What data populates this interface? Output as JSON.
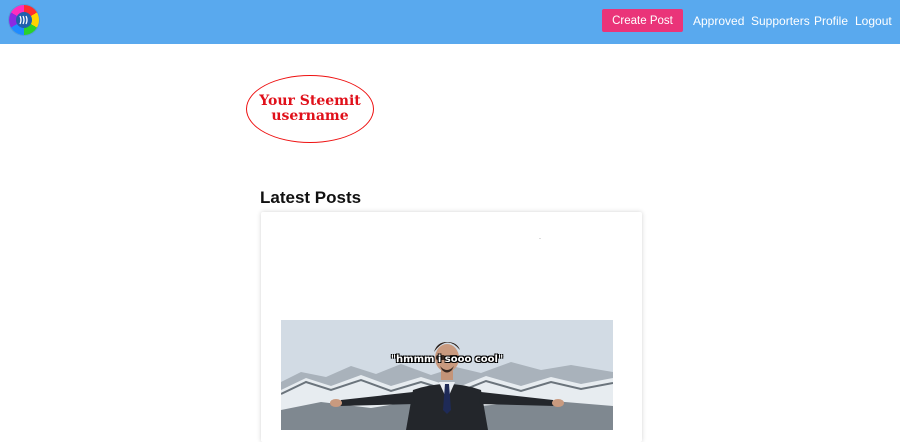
{
  "navbar": {
    "background": "#59a9ee",
    "logo_icon": "steemit-rainbow-logo",
    "create_post_label": "Create Post",
    "create_post_color": "#ea3479",
    "links": [
      "Approved",
      "Supporters",
      "Profile",
      "Logout"
    ]
  },
  "profile": {
    "username_line1": "Your Steemit",
    "username_line2": "username",
    "username_color": "#e0101a"
  },
  "latest": {
    "title": "Latest Posts",
    "post_image_caption": "\"hmmm i sooo cool\""
  }
}
